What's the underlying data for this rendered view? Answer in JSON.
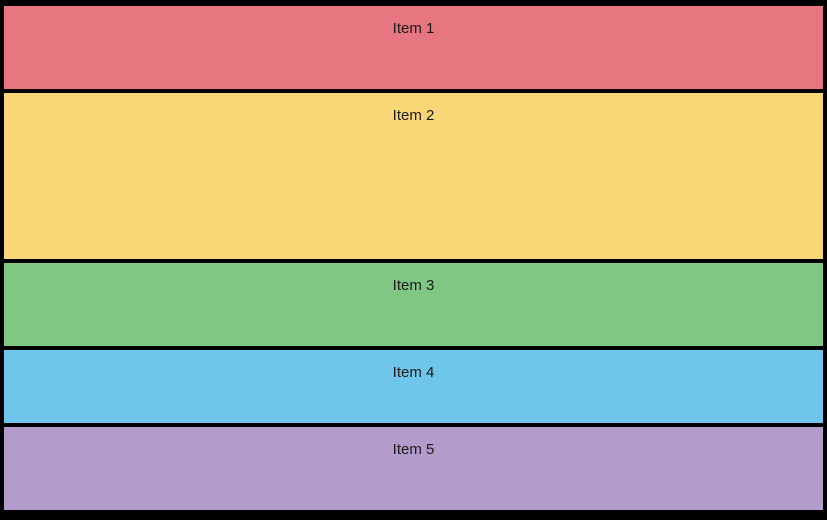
{
  "rows": [
    {
      "label": "Item 1",
      "color": "#e77681"
    },
    {
      "label": "Item 2",
      "color": "#fad776"
    },
    {
      "label": "Item 3",
      "color": "#81c784"
    },
    {
      "label": "Item 4",
      "color": "#6ec6eb"
    },
    {
      "label": "Item 5",
      "color": "#b39ccc"
    }
  ]
}
